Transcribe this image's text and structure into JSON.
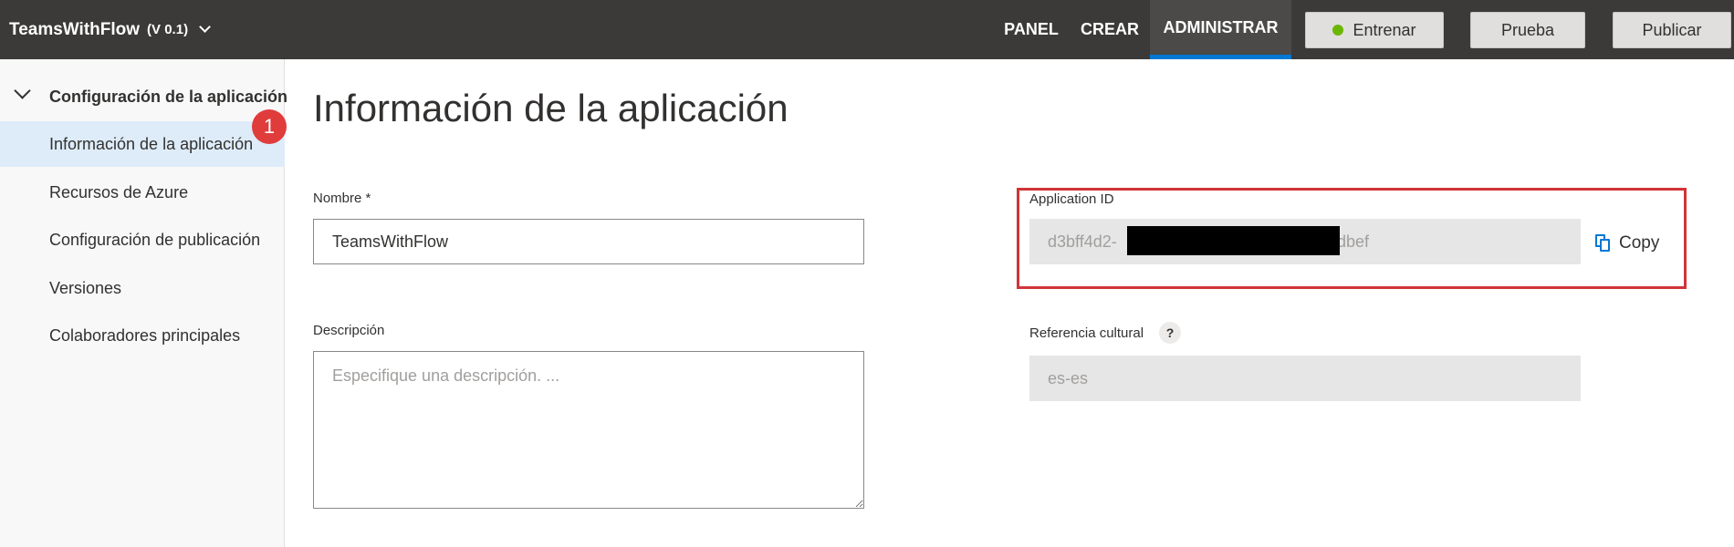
{
  "header": {
    "app_name": "TeamsWithFlow",
    "app_version": "(V 0.1)",
    "nav": [
      "PANEL",
      "CREAR",
      "ADMINISTRAR"
    ],
    "active_nav": "ADMINISTRAR",
    "buttons": {
      "train": "Entrenar",
      "test": "Prueba",
      "publish": "Publicar"
    },
    "train_status_color": "#6bb700",
    "accent_color": "#0078d4"
  },
  "sidebar": {
    "group_label": "Configuración de la aplicación",
    "items": [
      {
        "label": "Información de la aplicación",
        "active": true
      },
      {
        "label": "Recursos de Azure"
      },
      {
        "label": "Configuración de publicación"
      },
      {
        "label": "Versiones"
      },
      {
        "label": "Colaboradores principales"
      }
    ],
    "callout_badge": "1"
  },
  "main": {
    "title": "Información de la aplicación",
    "name_label": "Nombre *",
    "name_value": "TeamsWithFlow",
    "description_label": "Descripción",
    "description_placeholder": "Especifique una descripción. ...",
    "app_id_label": "Application ID",
    "app_id_visible_start": "d3bff4d2-",
    "app_id_visible_end": "dbef",
    "copy_label": "Copy",
    "culture_label": "Referencia cultural",
    "culture_help": "?",
    "culture_value": "es-es",
    "highlight_color": "#d13438"
  }
}
